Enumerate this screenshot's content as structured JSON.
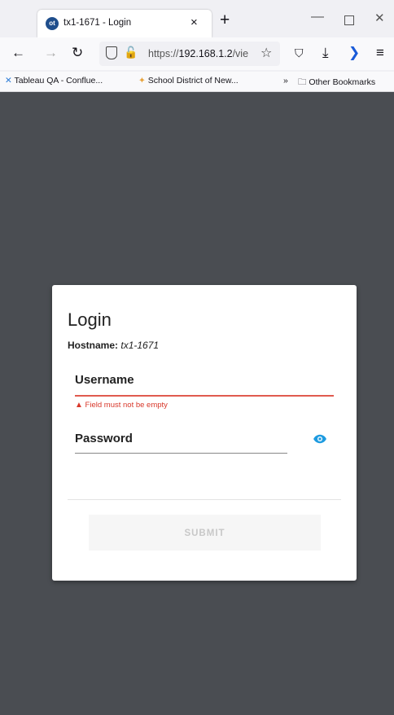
{
  "browser": {
    "tab_icon_text": "ot",
    "tab_title": "tx1-1671 - Login",
    "tab_close": "×",
    "new_tab": "+",
    "url_prefix": "https://",
    "url_host": "192.168.1.2",
    "url_rest": "/vie",
    "bookmarks": [
      "Tableau QA - Conflue...",
      "School District of New...",
      "Other Bookmarks"
    ],
    "overflow": "»"
  },
  "login": {
    "title": "Login",
    "hostname_label": "Hostname:",
    "hostname_value": "tx1-1671",
    "username_label": "Username",
    "username_error": "Field must not be empty",
    "password_label": "Password",
    "submit_label": "SUBMIT"
  },
  "colors": {
    "error": "#d8372a",
    "eye": "#1e9be0",
    "backdrop": "#4a4d52"
  }
}
